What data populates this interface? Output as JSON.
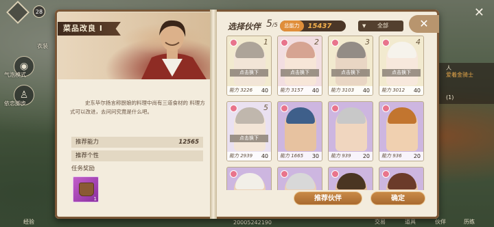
{
  "hud": {
    "level": "28",
    "left_label_1": "衣装",
    "left_label_2": "气泡模式",
    "left_label_3": "依恋脚步",
    "right_text_1": "人",
    "right_text_2": "爱着金骑士",
    "right_text_3": "(1)",
    "bottom_texts": [
      "经验",
      "20005242190",
      "交易",
      "道具",
      "伙伴",
      "历练"
    ]
  },
  "quest": {
    "title": "菜品改良 Ⅰ",
    "story": "史东毕尔扬言称厨娘的料理中尚有三道食材的 料理方式可以改进，去问问究竟是什么吧。",
    "recommended_power_label": "推荐能力",
    "recommended_power_value": "12565",
    "recommended_trait_label": "推荐个性",
    "reward_label": "任务奖励",
    "reward_count": "1"
  },
  "selection": {
    "title": "选择伙伴",
    "count": "5",
    "max": "/5",
    "total_power_label": "总能力",
    "total_power_value": "15437",
    "filter_label": "全部",
    "close_icon": "close-icon"
  },
  "cards": [
    {
      "slot": "1",
      "power": "能力 3226",
      "level": "40",
      "replace": "点击换下",
      "faded": true,
      "hair": "#6b5a45",
      "skin": "#e8cfb6",
      "bg": "#e8d9a8"
    },
    {
      "slot": "2",
      "power": "能力 3157",
      "level": "40",
      "replace": "点击换下",
      "faded": true,
      "hair": "#b45a3a",
      "skin": "#f0d2b8",
      "bg": "#e8c3c8"
    },
    {
      "slot": "3",
      "power": "能力 3103",
      "level": "40",
      "replace": "点击换下",
      "faded": true,
      "hair": "#3b2e24",
      "skin": "#d7b594",
      "bg": "#e8d9a8"
    },
    {
      "slot": "4",
      "power": "能力 3012",
      "level": "40",
      "replace": "点击换下",
      "faded": true,
      "hair": "#efe9dc",
      "skin": "#f0d6bf",
      "bg": "#e8d9a8"
    },
    {
      "slot": "5",
      "power": "能力 2939",
      "level": "40",
      "replace": "点击换下",
      "faded": true,
      "hair": "#8d7d6a",
      "skin": "#ead0b6",
      "bg": "#d9c8e6"
    },
    {
      "slot": "",
      "power": "能力 1665",
      "level": "30",
      "replace": "",
      "faded": false,
      "hair": "#3e5f8a",
      "skin": "#e7c2a0",
      "bg": "#cdb6e0"
    },
    {
      "slot": "",
      "power": "能力 939",
      "level": "20",
      "replace": "",
      "faded": false,
      "hair": "#c8c8c8",
      "skin": "#f0d6bf",
      "bg": "#cdb6e0"
    },
    {
      "slot": "",
      "power": "能力 936",
      "level": "20",
      "replace": "",
      "faded": false,
      "hair": "#c2752f",
      "skin": "#f0d0b0",
      "bg": "#cdb6e0"
    },
    {
      "slot": "",
      "power": "",
      "level": "",
      "replace": "",
      "faded": false,
      "hair": "#f2efe8",
      "skin": "#ecd0b5",
      "bg": "#cdb6e0"
    },
    {
      "slot": "",
      "power": "",
      "level": "",
      "replace": "",
      "faded": false,
      "hair": "#d8d8d8",
      "skin": "#ecd0b5",
      "bg": "#cdb6e0"
    },
    {
      "slot": "",
      "power": "",
      "level": "",
      "replace": "",
      "faded": false,
      "hair": "#4a3522",
      "skin": "#e2bc98",
      "bg": "#cdb6e0"
    },
    {
      "slot": "",
      "power": "",
      "level": "",
      "replace": "",
      "faded": false,
      "hair": "#6b3b2a",
      "skin": "#e9c6a6",
      "bg": "#cdb6e0"
    }
  ],
  "buttons": {
    "recommend": "推荐伙伴",
    "confirm": "确定"
  }
}
